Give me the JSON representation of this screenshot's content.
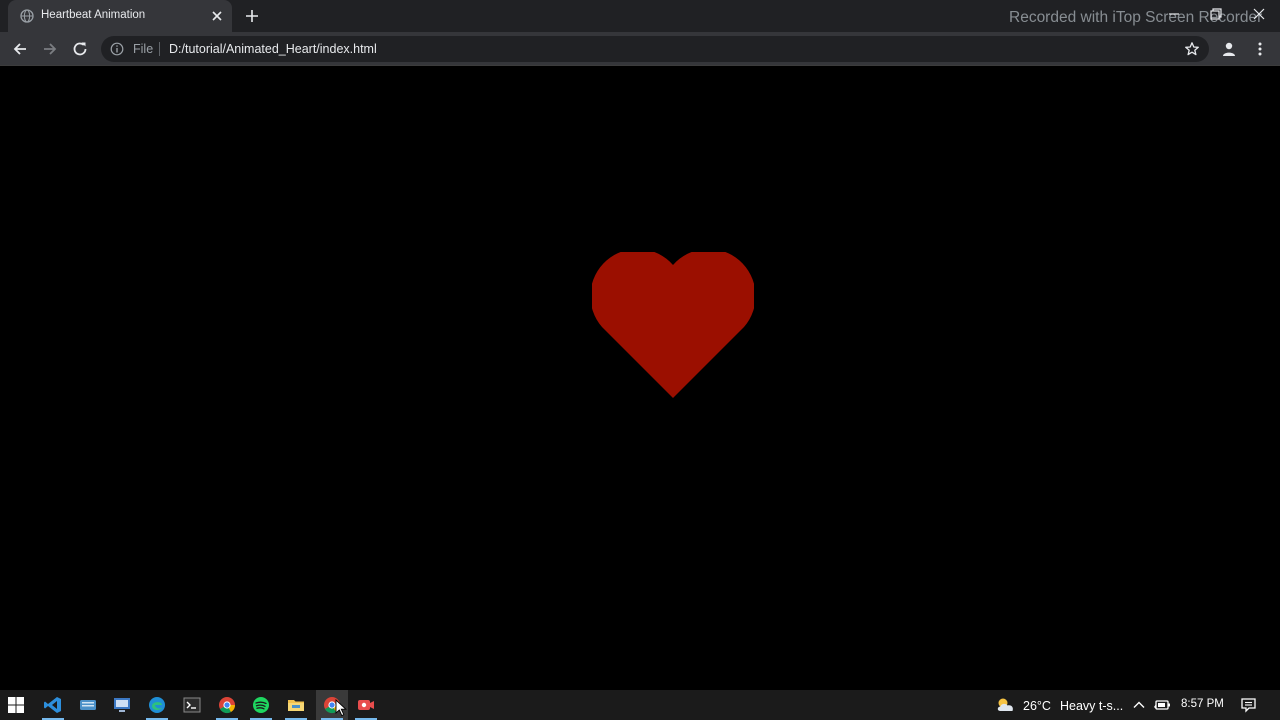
{
  "browser": {
    "tab": {
      "title": "Heartbeat Animation"
    },
    "omnibox": {
      "scheme_label": "File",
      "url": "D:/tutorial/Animated_Heart/index.html"
    },
    "watermark": "Recorded with iTop Screen Recorder"
  },
  "page": {
    "heart_color": "#9b0f00",
    "background_color": "#000000"
  },
  "taskbar": {
    "pinned_apps": [
      "start-icon",
      "vscode-icon",
      "keyboard-app-icon",
      "remote-desktop-icon",
      "edge-icon",
      "terminal-icon",
      "chrome-icon",
      "spotify-icon",
      "file-explorer-icon",
      "chrome-active-icon",
      "screen-recorder-icon"
    ],
    "weather": {
      "temp": "26°C",
      "description": "Heavy t-s..."
    },
    "clock": "8:57 PM"
  }
}
